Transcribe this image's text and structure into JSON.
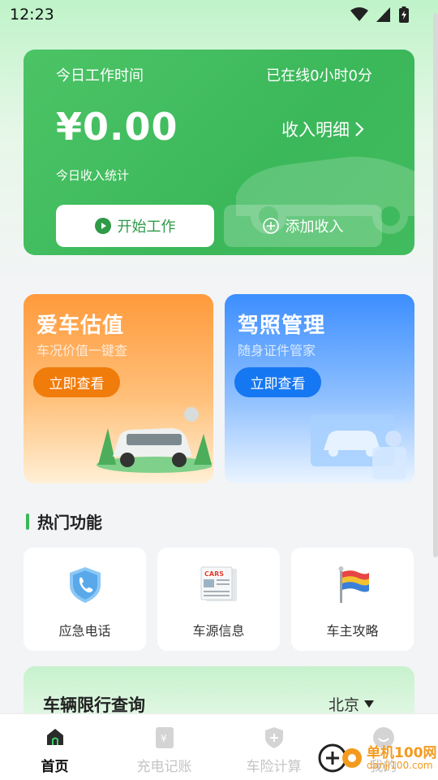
{
  "status_bar": {
    "time": "12:23"
  },
  "work_card": {
    "today_time_label": "今日工作时间",
    "online_label": "已在线0小时0分",
    "amount": "¥0.00",
    "detail_label": "收入明细",
    "stat_label": "今日收入统计",
    "start_button": "开始工作",
    "add_button": "添加收入"
  },
  "promos": [
    {
      "title": "爱车估值",
      "subtitle": "车况价值一键查",
      "button": "立即查看"
    },
    {
      "title": "驾照管理",
      "subtitle": "随身证件管家",
      "button": "立即查看"
    }
  ],
  "hot_section": {
    "title": "热门功能",
    "items": [
      {
        "label": "应急电话",
        "icon": "shield-phone-icon"
      },
      {
        "label": "车源信息",
        "icon": "cars-newspaper-icon"
      },
      {
        "label": "车主攻略",
        "icon": "flag-icon"
      }
    ]
  },
  "restriction": {
    "title": "车辆限行查询",
    "city": "北京"
  },
  "bottom_nav": {
    "items": [
      {
        "label": "首页",
        "active": true
      },
      {
        "label": "充电记账",
        "active": false
      },
      {
        "label": "车险计算",
        "active": false
      },
      {
        "label": "我的",
        "active": false
      }
    ]
  },
  "watermark": {
    "name": "单机100网",
    "url": "danji100.com"
  },
  "colors": {
    "brand_green": "#3bb85a",
    "orange": "#f07c0c",
    "blue": "#1677f2"
  }
}
